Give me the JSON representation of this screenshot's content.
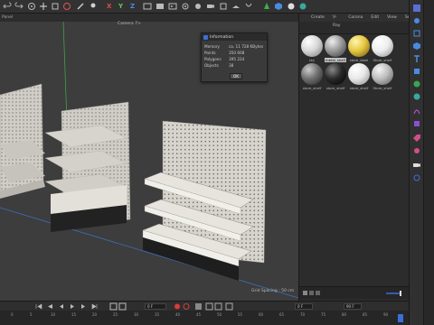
{
  "toolbar": {
    "axes": [
      "X",
      "Y",
      "Z"
    ],
    "axis_colors": [
      "#e14b4b",
      "#63c85a",
      "#4a8be0"
    ]
  },
  "viewport": {
    "menu": "Panel",
    "camera_label": "Camera 7>",
    "grid_spacing": "Grid Spacing : 50 cm"
  },
  "dialog": {
    "title": "Information",
    "rows": [
      {
        "key": "Memory",
        "value": "ca. 11 728 KBytes"
      },
      {
        "key": "Points",
        "value": "350 608"
      },
      {
        "key": "Polygons",
        "value": "395 224"
      },
      {
        "key": "Objects",
        "value": "38"
      }
    ],
    "ok_label": "OK"
  },
  "materials": {
    "menu": [
      "Create",
      "V-Ray",
      "Corona",
      "Edit",
      "View",
      "Select"
    ],
    "items": [
      {
        "label": "sky",
        "selected": false,
        "color": "#d8d8d8"
      },
      {
        "label": "metal_shelf",
        "selected": true,
        "color": "#9a9a9a"
      },
      {
        "label": "store_label",
        "selected": false,
        "color": "#e6c640"
      },
      {
        "label": "Store_shelf",
        "selected": false,
        "color": "#ededed"
      },
      {
        "label": "store_shelf",
        "selected": false,
        "color": "#707070"
      },
      {
        "label": "store_shelf",
        "selected": false,
        "color": "#2a2a2a"
      },
      {
        "label": "store_shelf",
        "selected": false,
        "color": "#e8e8e8"
      },
      {
        "label": "Store_shelf",
        "selected": false,
        "color": "#bdbdbd"
      }
    ]
  },
  "timeline": {
    "current_frame": "0 F",
    "start_field": "0 F",
    "end_field": "90 F",
    "ticks": [
      "0",
      "5",
      "10",
      "15",
      "20",
      "25",
      "30",
      "35",
      "40",
      "45",
      "50",
      "55",
      "60",
      "65",
      "70",
      "75",
      "80",
      "85",
      "90"
    ]
  }
}
